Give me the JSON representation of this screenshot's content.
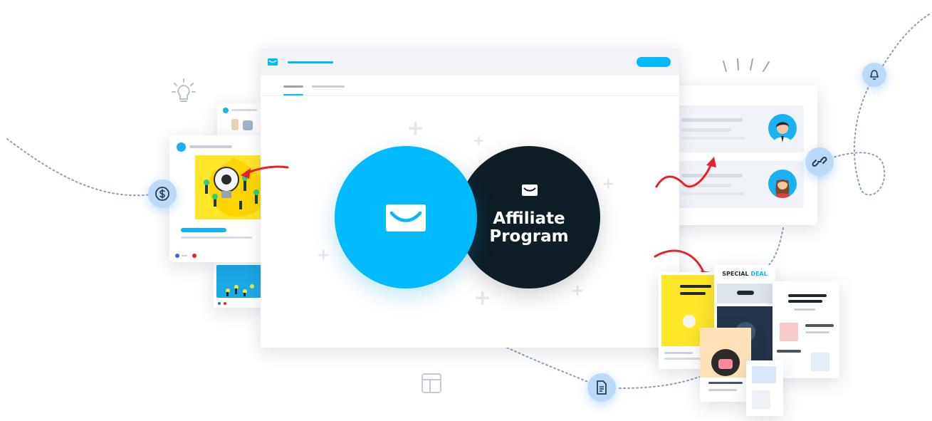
{
  "hero": {
    "title_line1": "Affiliate",
    "title_line2": "Program"
  },
  "newsletter": {
    "headline": "SPECIAL",
    "headline_accent": "DEAL"
  },
  "colors": {
    "brand_blue": "#00baff",
    "dark_navy": "#0e1d26",
    "arrow_red": "#e8202a",
    "accent_yellow": "#ffe629",
    "node_blue": "#bcd9f7"
  },
  "icons": [
    "mail-icon",
    "lightbulb-icon",
    "dollar-icon",
    "bell-icon",
    "link-icon",
    "document-icon",
    "layout-icon",
    "user-avatar"
  ]
}
